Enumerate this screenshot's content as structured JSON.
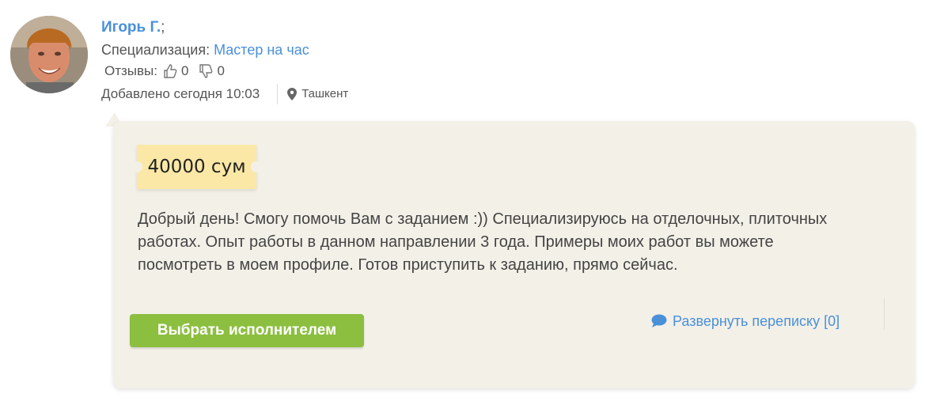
{
  "user": {
    "name": "Игорь Г.",
    "name_suffix": ";",
    "specialization_label": "Специализация:",
    "specialization_value": "Мастер на час",
    "reviews_label": "Отзывы:",
    "reviews_positive": "0",
    "reviews_negative": "0",
    "added_text": "Добавлено сегодня 10:03",
    "location": "Ташкент"
  },
  "offer": {
    "price": "40000 сум",
    "message": "Добрый день! Смогу помочь Вам с заданием :)) Специализируюсь на отделочных, плиточных работах. Опыт работы в данном направлении 3 года. Примеры моих работ вы можете посмотреть в моем профиле. Готов приступить к заданию, прямо сейчас.",
    "select_button": "Выбрать исполнителем",
    "expand_link": "Развернуть переписку [0]"
  },
  "icons": {
    "thumb_up": "thumb-up-icon",
    "thumb_down": "thumb-down-icon",
    "location": "map-pin-icon",
    "chat": "chat-bubble-icon"
  },
  "colors": {
    "link": "#4a90d9",
    "button": "#8cbf3f",
    "bubble_bg": "#f3f0e8",
    "price_bg": "#fbe8a6"
  }
}
